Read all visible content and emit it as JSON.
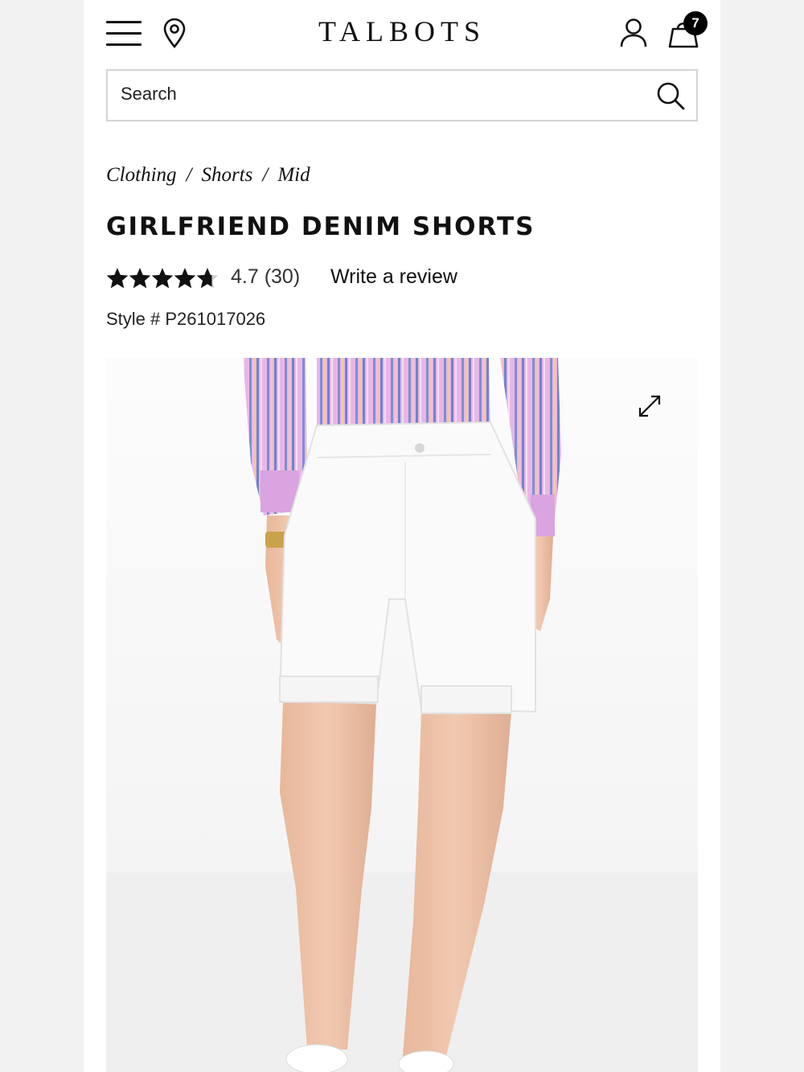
{
  "header": {
    "logo": "TALBOTS",
    "bag_count": "7",
    "icons": [
      "menu-icon",
      "location-pin-icon",
      "account-icon",
      "shopping-bag-icon"
    ]
  },
  "search": {
    "placeholder": "Search"
  },
  "breadcrumb": [
    "Clothing",
    "Shorts",
    "Mid"
  ],
  "product": {
    "title": "GIRLFRIEND DENIM SHORTS",
    "rating_value": 4.7,
    "rating_max": 5,
    "rating_text": "4.7 (30)",
    "review_link": "Write a review",
    "style_number": "Style # P261017026"
  },
  "colors": {
    "text": "#111111",
    "badge": "#000000",
    "border": "#d4d4d4"
  }
}
